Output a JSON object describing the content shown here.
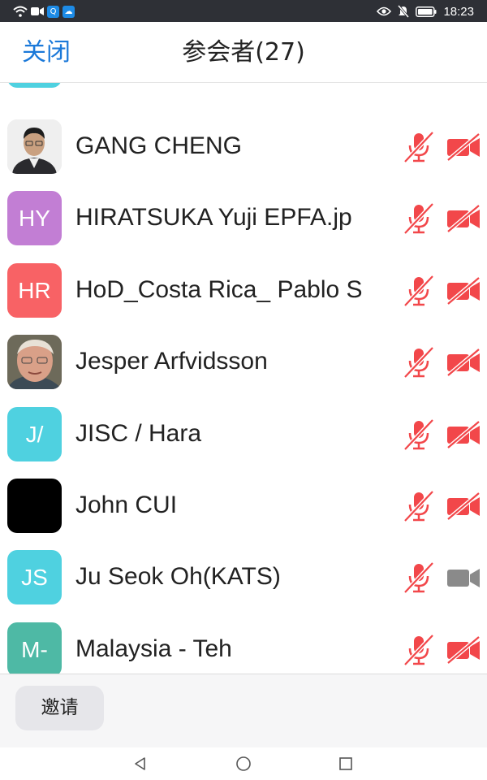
{
  "status_bar": {
    "time": "18:23"
  },
  "header": {
    "close_label": "关闭",
    "title": "参会者(27)"
  },
  "participants": [
    {
      "name": "GANG CHENG",
      "avatar_type": "photo",
      "initials": "",
      "avatar_color": "#e8e8e8",
      "mic_muted": true,
      "video_off": true
    },
    {
      "name": "HIRATSUKA Yuji EPFA.jp",
      "avatar_type": "initials",
      "initials": "HY",
      "avatar_color": "#c27ed4",
      "mic_muted": true,
      "video_off": true
    },
    {
      "name": "HoD_Costa Rica_ Pablo S",
      "avatar_type": "initials",
      "initials": "HR",
      "avatar_color": "#f86265",
      "mic_muted": true,
      "video_off": true
    },
    {
      "name": "Jesper Arfvidsson",
      "avatar_type": "photo",
      "initials": "",
      "avatar_color": "#c9a38d",
      "mic_muted": true,
      "video_off": true
    },
    {
      "name": "JISC /  Hara",
      "avatar_type": "initials",
      "initials": "J/",
      "avatar_color": "#4fd1e0",
      "mic_muted": true,
      "video_off": true
    },
    {
      "name": "John CUI",
      "avatar_type": "initials",
      "initials": "",
      "avatar_color": "#000000",
      "mic_muted": true,
      "video_off": true
    },
    {
      "name": "Ju Seok Oh(KATS)",
      "avatar_type": "initials",
      "initials": "JS",
      "avatar_color": "#4fd1e0",
      "mic_muted": true,
      "video_off": false
    },
    {
      "name": "Malaysia - Teh",
      "avatar_type": "initials",
      "initials": "M-",
      "avatar_color": "#4eb9a5",
      "mic_muted": true,
      "video_off": true
    }
  ],
  "footer": {
    "invite_label": "邀请"
  },
  "colors": {
    "accent": "#1b79d9",
    "muted_red": "#f2474a",
    "video_on_gray": "#8a8a8a"
  }
}
